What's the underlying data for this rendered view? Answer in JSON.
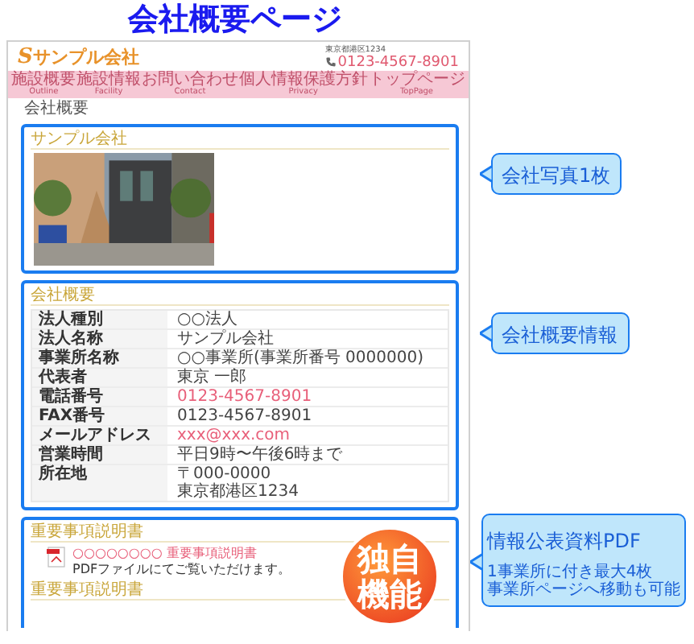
{
  "title": "会社概要ページ",
  "site": {
    "logo_mark": "S",
    "logo": "サンプル会社",
    "address": "東京都港区1234",
    "phone": "0123-4567-8901"
  },
  "nav": [
    {
      "label": "施設概要",
      "sub": "Outline"
    },
    {
      "label": "施設情報",
      "sub": "Facility"
    },
    {
      "label": "お問い合わせ",
      "sub": "Contact"
    },
    {
      "label": "個人情報保護方針",
      "sub": "Privacy"
    },
    {
      "label": "トップページ",
      "sub": "TopPage"
    }
  ],
  "breadcrumb": "会社概要",
  "photo_section": {
    "heading": "サンプル会社"
  },
  "profile": {
    "heading": "会社概要",
    "rows": [
      {
        "label": "法人種別",
        "kind": "text",
        "value": [
          "○○法人"
        ]
      },
      {
        "label": "法人名称",
        "kind": "text",
        "value": [
          "サンプル会社"
        ]
      },
      {
        "label": "事業所名称",
        "kind": "text",
        "value": [
          "○○事業所(事業所番号 0000000)"
        ]
      },
      {
        "label": "代表者",
        "kind": "text",
        "value": [
          "東京 一郎"
        ]
      },
      {
        "label": "電話番号",
        "kind": "link",
        "value": [
          "0123-4567-8901"
        ]
      },
      {
        "label": "FAX番号",
        "kind": "text",
        "value": [
          "0123-4567-8901"
        ]
      },
      {
        "label": "メールアドレス",
        "kind": "link",
        "value": [
          "xxx@xxx.com"
        ]
      },
      {
        "label": "営業時間",
        "kind": "text",
        "value": [
          "平日9時〜午後6時まで"
        ]
      },
      {
        "label": "所在地",
        "kind": "text",
        "value": [
          "〒000-0000",
          "東京都港区1234"
        ]
      }
    ]
  },
  "pdf_sections": [
    {
      "heading": "重要事項説明書",
      "link": "○○○○○○○○ 重要事項説明書",
      "note": "PDFファイルにてご覧いただけます。"
    },
    {
      "heading": "重要事項説明書"
    }
  ],
  "badge": [
    "独自",
    "機能"
  ],
  "callouts": [
    {
      "text": "会社写真1枚"
    },
    {
      "text": "会社概要情報"
    },
    {
      "text": "情報公表資料PDF",
      "note": [
        "1事業所に付き最大4枚",
        "事業所ページへ移動も可能"
      ]
    }
  ]
}
